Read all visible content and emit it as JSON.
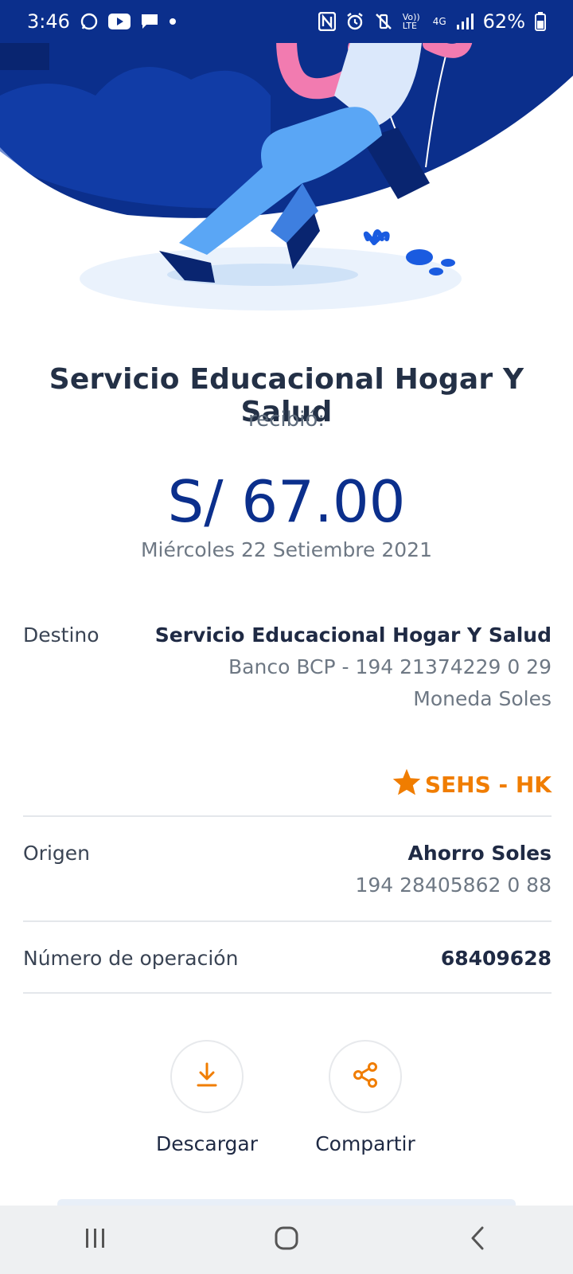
{
  "status_bar": {
    "time": "3:46",
    "network": "4G",
    "volte": "Vo)) LTE",
    "battery": "62%"
  },
  "receipt": {
    "recipient_title": "Servicio Educacional Hogar Y Salud",
    "received_label": "recibió:",
    "amount": "S/ 67.00",
    "date": "Miércoles 22 Setiembre 2021"
  },
  "destination": {
    "label": "Destino",
    "name": "Servicio Educacional Hogar Y Salud",
    "account": "Banco BCP - 194 21374229 0 29",
    "currency": "Moneda Soles",
    "favorite_alias": "SEHS - HK"
  },
  "origin": {
    "label": "Origen",
    "account_name": "Ahorro Soles",
    "account_number": "194 28405862 0 88"
  },
  "operation": {
    "label": "Número de operación",
    "number": "68409628"
  },
  "actions": {
    "download_label": "Descargar",
    "share_label": "Compartir"
  },
  "colors": {
    "brand_blue": "#0b2f8c",
    "accent_orange": "#f07d00"
  },
  "icons": {
    "download": "download-icon",
    "share": "share-icon",
    "favorite": "star-icon",
    "nav_recents": "recents-icon",
    "nav_home": "home-icon",
    "nav_back": "back-icon"
  }
}
